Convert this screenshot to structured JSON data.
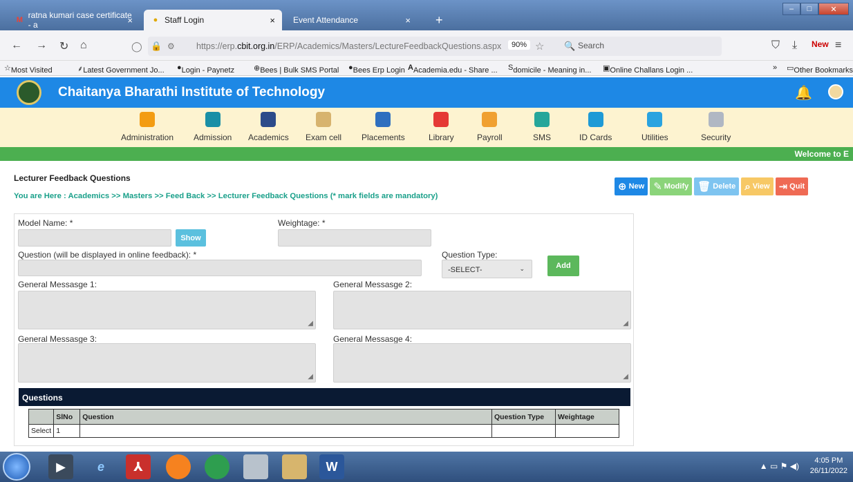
{
  "browser": {
    "tabs": [
      {
        "label": "ratna kumari case certificate - a",
        "icon": "gmail-icon"
      },
      {
        "label": "Staff Login",
        "icon": "bee-icon",
        "active": true
      },
      {
        "label": "Event Attendance",
        "icon": ""
      }
    ],
    "new_tab": "+",
    "url_prefix": "https://erp.",
    "url_domain": "cbit.org.in",
    "url_path": "/ERP/Academics/Masters/LectureFeedbackQuestions.aspx",
    "zoom": "90%",
    "search_placeholder": "Search",
    "bookmarks": [
      "Most Visited",
      "Latest Government Jo...",
      "Login - Paynetz",
      "Bees | Bulk SMS Portal",
      "Bees Erp Login",
      "Academia.edu - Share ...",
      "domicile - Meaning in...",
      "Online Challans Login ..."
    ],
    "other_bookmarks": "Other Bookmarks"
  },
  "app": {
    "title": "Chaitanya Bharathi Institute of Technology",
    "menu": [
      "Administration",
      "Admission",
      "Academics",
      "Exam cell",
      "Placements",
      "Library",
      "Payroll",
      "SMS",
      "ID Cards",
      "Utilities",
      "Security"
    ],
    "welcome": "Welcome to E"
  },
  "page": {
    "title": "Lecturer Feedback Questions",
    "breadcrumb": "You are Here : Academics >> Masters >> Feed Back >> Lecturer Feedback Questions (* mark fields are mandatory)",
    "actions": {
      "new": "New",
      "modify": "Modify",
      "delete": "Delete",
      "view": "View",
      "quit": "Quit"
    }
  },
  "form": {
    "model_name_label": "Model Name: *",
    "show_button": "Show",
    "weightage_label": "Weightage: *",
    "question_label": "Question (will be displayed in online feedback): *",
    "question_type_label": "Question Type:",
    "question_type_value": "-SELECT-",
    "add_button": "Add",
    "msg1_label": "General Messasge 1:",
    "msg2_label": "General Messasge 2:",
    "msg3_label": "General Messasge 3:",
    "msg4_label": "General Messasge 4:"
  },
  "questions": {
    "header": "Questions",
    "columns": [
      "",
      "SlNo",
      "Question",
      "Question Type",
      "Weightage"
    ],
    "rows": [
      {
        "select": "Select",
        "slno": "1",
        "question": "",
        "type": "",
        "weightage": ""
      }
    ]
  },
  "taskbar": {
    "time": "4:05 PM",
    "date": "26/11/2022"
  }
}
